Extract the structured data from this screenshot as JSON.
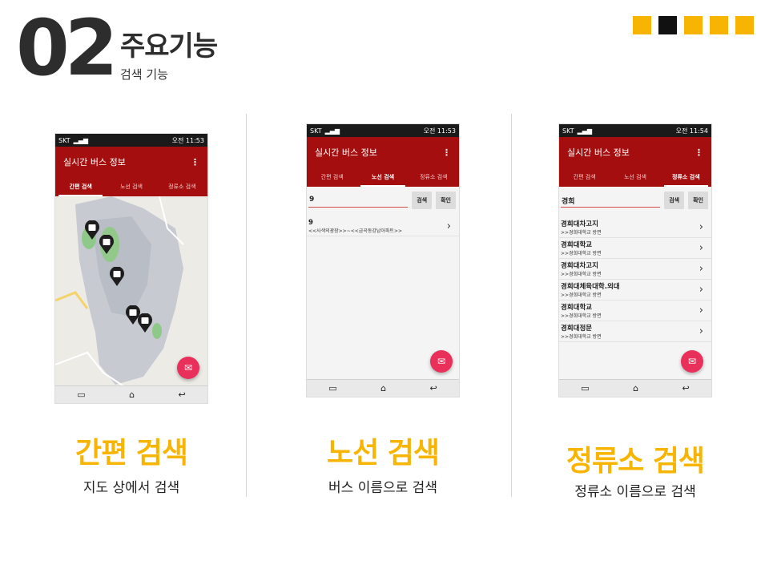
{
  "header": {
    "number": "02",
    "title": "주요기능",
    "subtitle": "검색 기능"
  },
  "squares": [
    "#f7b400",
    "#111111",
    "#f7b400",
    "#f7b400",
    "#f7b400"
  ],
  "colors": {
    "accent": "#f7b400",
    "app_red": "#a50e0e",
    "fab": "#e8305a"
  },
  "phones": {
    "map": {
      "carrier": "SKT",
      "time": "오전 11:53",
      "app_title": "실시간 버스 정보",
      "tabs": [
        "간편 검색",
        "노선 검색",
        "정류소 검색"
      ],
      "active_tab": 0
    },
    "route": {
      "carrier": "SKT",
      "time": "오전 11:53",
      "app_title": "실시간 버스 정보",
      "tabs": [
        "간편 검색",
        "노선 검색",
        "정류소 검색"
      ],
      "active_tab": 1,
      "search_value": "9",
      "search_button": "검색",
      "confirm_button": "확인",
      "results": [
        {
          "name": "9",
          "detail": "<<사색의광장>>~<<금곡동강남아파트>>"
        }
      ]
    },
    "stop": {
      "carrier": "SKT",
      "time": "오전 11:54",
      "app_title": "실시간 버스 정보",
      "tabs": [
        "간편 검색",
        "노선 검색",
        "정류소 검색"
      ],
      "active_tab": 2,
      "search_value": "경희",
      "search_button": "검색",
      "confirm_button": "확인",
      "results": [
        {
          "name": "경희대차고지",
          "detail": ">>경희대학교 방면"
        },
        {
          "name": "경희대학교",
          "detail": ">>경희대학교 방면"
        },
        {
          "name": "경희대차고지",
          "detail": ">>경희대학교 방면"
        },
        {
          "name": "경희대체육대학.외대",
          "detail": ">>경희대학교 방면"
        },
        {
          "name": "경희대학교",
          "detail": ">>경희대학교 방면"
        },
        {
          "name": "경희대정문",
          "detail": ">>경희대학교 방면"
        }
      ]
    }
  },
  "features": [
    {
      "title": "간편 검색",
      "desc": "지도 상에서 검색"
    },
    {
      "title": "노선 검색",
      "desc": "버스 이름으로 검색"
    },
    {
      "title": "정류소 검색",
      "desc": "정류소 이름으로 검색"
    }
  ]
}
